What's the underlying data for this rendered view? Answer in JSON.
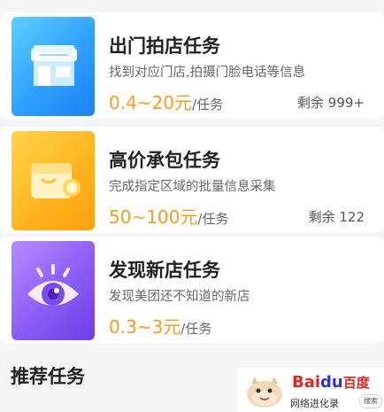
{
  "tasks": [
    {
      "title": "出门拍店任务",
      "description": "找到对应门店,拍摄门脸电话等信息",
      "price": "0.4~20元",
      "unit": "/任务",
      "remaining": "剩余 999+",
      "icon": "storefront-icon"
    },
    {
      "title": "高价承包任务",
      "description": "完成指定区域的批量信息采集",
      "price": "50~100元",
      "unit": "/任务",
      "remaining": "剩余 122",
      "icon": "wallet-coin-icon"
    },
    {
      "title": "发现新店任务",
      "description": "发现美团还不知道的新店",
      "price": "0.3~3元",
      "unit": "/任务",
      "remaining": "",
      "icon": "eye-icon"
    }
  ],
  "section": {
    "title": "推荐任务"
  },
  "watermark": {
    "logo_bai": "Bai",
    "logo_du": "du",
    "logo_cn": "百度",
    "sub": "网络进化录",
    "search": "搜索"
  },
  "colors": {
    "price": "#ff9a1e",
    "tile_blue": "#2f9fff",
    "tile_orange": "#ffb21d",
    "tile_purple": "#8a5cf5"
  }
}
